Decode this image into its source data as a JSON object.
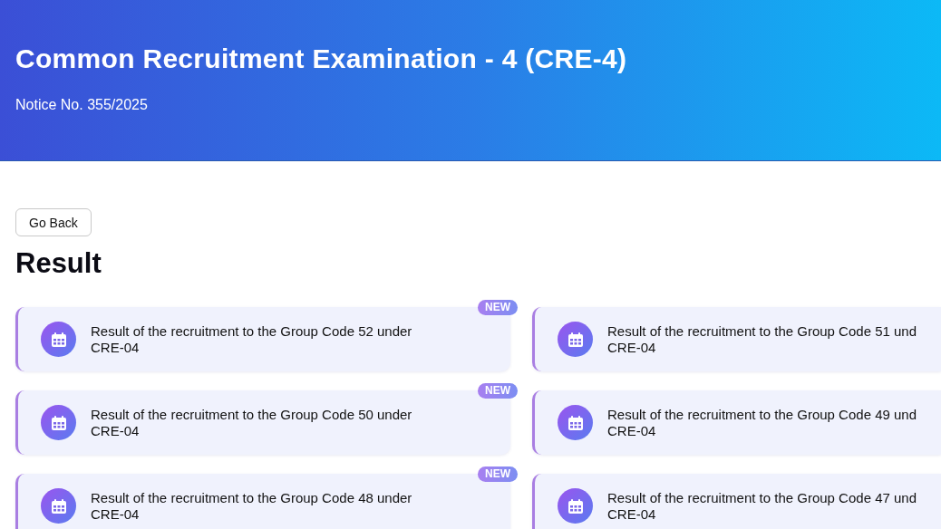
{
  "header": {
    "title": "Common Recruitment Examination - 4 (CRE-4)",
    "notice": "Notice No. 355/2025"
  },
  "back_button": "Go Back",
  "section_title": "Result",
  "results": [
    {
      "title": "Result of the recruitment to the Group Code 52 under\nCRE-04",
      "badge": "NEW"
    },
    {
      "title": "Result of the recruitment to the Group Code 51 und\nCRE-04"
    },
    {
      "title": "Result of the recruitment to the Group Code 50 under\nCRE-04",
      "badge": "NEW"
    },
    {
      "title": "Result of the recruitment to the Group Code 49 und\nCRE-04"
    },
    {
      "title": "Result of the recruitment to the Group Code 48 under\nCRE-04",
      "badge": "NEW"
    },
    {
      "title": "Result of the recruitment to the Group Code 47 und\nCRE-04"
    }
  ]
}
